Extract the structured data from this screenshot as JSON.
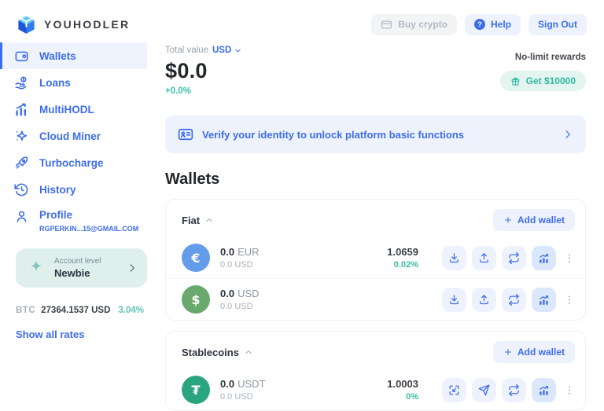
{
  "header": {
    "brand": "YOUHODLER",
    "buy_crypto_label": "Buy crypto",
    "help_label": "Help",
    "sign_out_label": "Sign Out"
  },
  "sidebar": {
    "items": [
      {
        "label": "Wallets",
        "active": true
      },
      {
        "label": "Loans"
      },
      {
        "label": "MultiHODL"
      },
      {
        "label": "Cloud Miner"
      },
      {
        "label": "Turbocharge"
      },
      {
        "label": "History"
      },
      {
        "label": "Profile",
        "email": "RGPERKIN...15@GMAIL.COM"
      }
    ],
    "account_level": {
      "label": "Account level",
      "value": "Newbie"
    },
    "btc_rate": {
      "symbol": "BTC",
      "price": "27364.1537 USD",
      "change": "3.04%"
    },
    "show_all_rates_label": "Show all rates"
  },
  "summary": {
    "total_value_label": "Total value",
    "currency": "USD",
    "amount": "$0.0",
    "change": "+0.0%",
    "rewards_label": "No-limit rewards",
    "rewards_button_label": "Get $10000"
  },
  "banner": {
    "text": "Verify your identity to unlock platform basic functions"
  },
  "wallets": {
    "title": "Wallets",
    "add_wallet_label": "Add wallet",
    "groups": [
      {
        "name": "Fiat",
        "rows": [
          {
            "symbol": "€",
            "balance": "0.0",
            "currency": "EUR",
            "fiat_value": "0.0 USD",
            "rate": "1.0659",
            "rate_change": "0.02%",
            "color": "#639CE8"
          },
          {
            "symbol": "$",
            "balance": "0.0",
            "currency": "USD",
            "fiat_value": "0.0 USD",
            "rate": "",
            "rate_change": "",
            "color": "#69A96E"
          }
        ]
      },
      {
        "name": "Stablecoins",
        "rows": [
          {
            "symbol": "₮",
            "balance": "0.0",
            "currency": "USDT",
            "fiat_value": "0.0 USD",
            "rate": "1.0003",
            "rate_change": "0%",
            "color": "#2BA57F"
          }
        ]
      }
    ]
  },
  "icons": {
    "header": [
      "youhodler-logo-icon",
      "credit-card-icon",
      "question-circle-icon"
    ],
    "sidebar": [
      "wallet-icon",
      "loans-icon",
      "multihodl-chart-icon",
      "cloud-miner-sparkle-icon",
      "turbocharge-rocket-icon",
      "history-icon",
      "profile-person-icon",
      "account-level-star-icon",
      "chevron-right-icon"
    ],
    "summary": [
      "chevron-down-icon",
      "gift-icon"
    ],
    "banner": [
      "id-card-icon",
      "chevron-right-icon"
    ],
    "wallet_actions_fiat": [
      "deposit-icon",
      "withdraw-icon",
      "exchange-icon",
      "chart-icon",
      "more-dots-icon"
    ],
    "wallet_actions_stablecoin": [
      "receive-scan-icon",
      "send-icon",
      "exchange-icon",
      "chart-icon",
      "more-dots-icon"
    ],
    "group": [
      "chevron-up-icon",
      "plus-icon"
    ]
  },
  "colors": {
    "accent_blue": "#3D6DEB",
    "light_blue_bg": "#EDF2FE",
    "sidebar_active_bg": "#EEF3FE",
    "banner_bg": "#EEF2FD",
    "positive_green": "#3ABE9E",
    "mint_bg": "#E4F4F0",
    "mint_text": "#2FB9A0",
    "account_box_bg": "#DFEFEC",
    "eur_coin": "#639CE8",
    "usd_coin": "#69A96E",
    "usdt_coin": "#2BA57F"
  }
}
